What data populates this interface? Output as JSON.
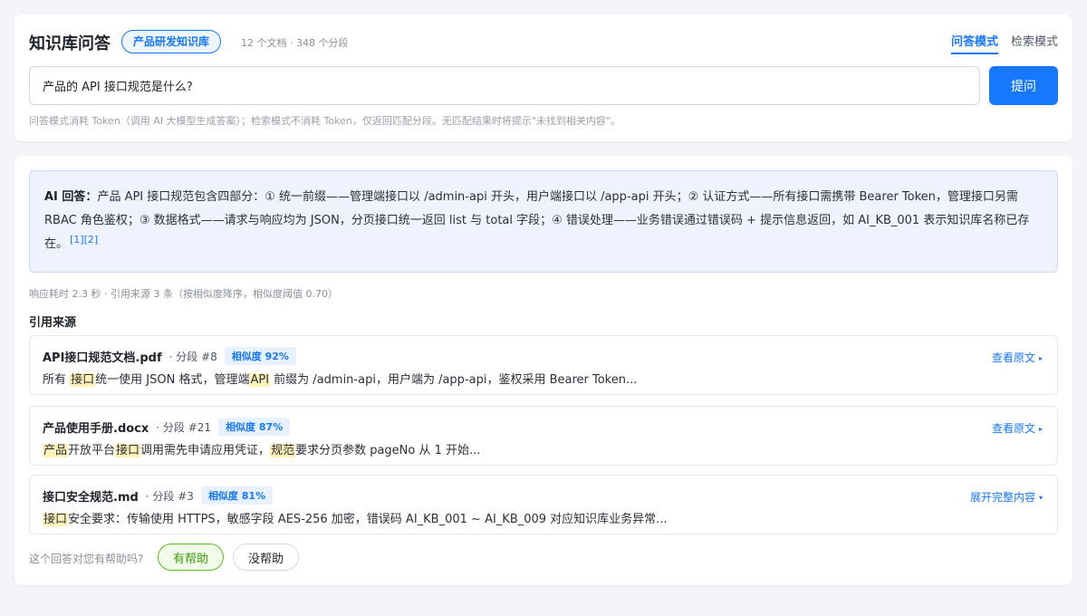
{
  "header": {
    "title": "知识库问答",
    "kb_name": "产品研发知识库",
    "kb_meta": "12 个文档 · 348 个分段",
    "tabs": [
      {
        "label": "问答模式",
        "active": true
      },
      {
        "label": "检索模式",
        "active": false
      }
    ]
  },
  "query": {
    "value": "产品的 API 接口规范是什么?",
    "submit_label": "提问",
    "hint": "问答模式消耗 Token（调用 AI 大模型生成答案）；检索模式不消耗 Token，仅返回匹配分段。无匹配结果时将提示\"未找到相关内容\"。"
  },
  "answer": {
    "label": "AI 回答：",
    "text": "产品 API 接口规范包含四部分：① 统一前缀——管理端接口以 /admin-api 开头，用户端接口以 /app-api 开头；② 认证方式——所有接口需携带 Bearer Token，管理接口另需 RBAC 角色鉴权；③ 数据格式——请求与响应均为 JSON，分页接口统一返回 list 与 total 字段；④ 错误处理——业务错误通过错误码 + 提示信息返回，如 AI_KB_001 表示知识库名称已存在。",
    "citations": "[1][2]"
  },
  "response_meta": "响应耗时 2.3 秒 · 引用来源 3 条（按相似度降序，相似度阈值 0.70）",
  "sources_heading": "引用来源",
  "sources": [
    {
      "name": "API接口规范文档.pdf",
      "segment": "· 分段 #8",
      "similarity": "相似度 92%",
      "action": "查看原文",
      "action_caret": "▸",
      "snippet": [
        {
          "t": "所有 ",
          "hl": false
        },
        {
          "t": "接口",
          "hl": true
        },
        {
          "t": "统一使用 JSON 格式，管理端",
          "hl": false
        },
        {
          "t": "API",
          "hl": true
        },
        {
          "t": " 前缀为 /admin-api，用户端为 /app-api，鉴权采用 Bearer Token...",
          "hl": false
        }
      ]
    },
    {
      "name": "产品使用手册.docx",
      "segment": "· 分段 #21",
      "similarity": "相似度 87%",
      "action": "查看原文",
      "action_caret": "▸",
      "snippet": [
        {
          "t": "产品",
          "hl": true
        },
        {
          "t": "开放平台",
          "hl": false
        },
        {
          "t": "接口",
          "hl": true
        },
        {
          "t": "调用需先申请应用凭证，",
          "hl": false
        },
        {
          "t": "规范",
          "hl": true
        },
        {
          "t": "要求分页参数 pageNo 从 1 开始...",
          "hl": false
        }
      ]
    },
    {
      "name": "接口安全规范.md",
      "segment": "· 分段 #3",
      "similarity": "相似度 81%",
      "action": "展开完整内容",
      "action_caret": "▾",
      "snippet": [
        {
          "t": "接口",
          "hl": true
        },
        {
          "t": "安全要求：传输使用 HTTPS，敏感字段 AES-256 加密，错误码 AI_KB_001 ~ AI_KB_009 对应知识库业务异常...",
          "hl": false
        }
      ]
    }
  ],
  "feedback": {
    "question": "这个回答对您有帮助吗?",
    "yes_label": "有帮助",
    "no_label": "没帮助"
  },
  "colors": {
    "accent": "#1677ff",
    "highlight": "#fff2b8",
    "positive": "#52c41a"
  }
}
